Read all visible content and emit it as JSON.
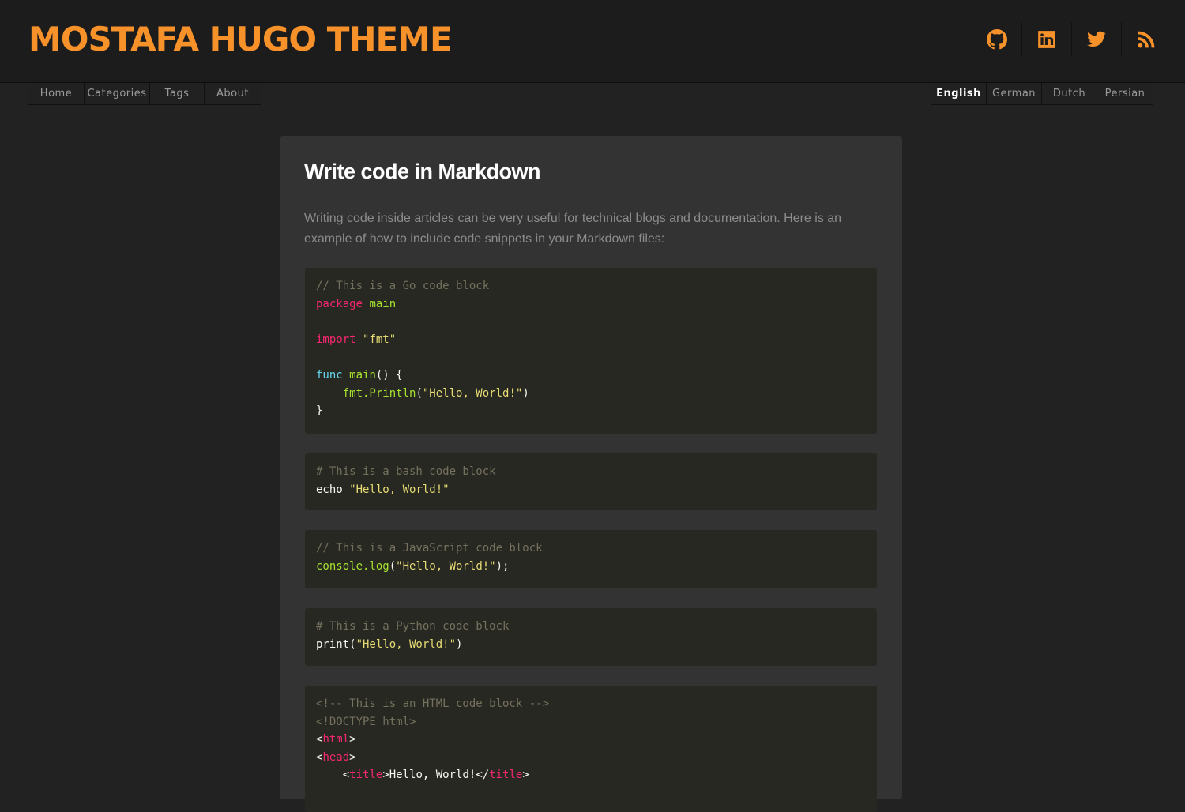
{
  "site": {
    "title": "MOSTAFA HUGO THEME",
    "accent_color": "#f7922b",
    "social_icons": [
      "github-icon",
      "linkedin-icon",
      "twitter-icon",
      "rss-icon"
    ]
  },
  "nav": {
    "main": [
      {
        "label": "Home"
      },
      {
        "label": "Categories"
      },
      {
        "label": "Tags"
      },
      {
        "label": "About"
      }
    ],
    "languages": [
      {
        "label": "English",
        "active": true
      },
      {
        "label": "German"
      },
      {
        "label": "Dutch"
      },
      {
        "label": "Persian"
      }
    ]
  },
  "article": {
    "title": "Write code in Markdown",
    "intro": "Writing code inside articles can be very useful for technical blogs and documentation. Here is an example of how to include code snippets in your Markdown files:"
  },
  "code_blocks": {
    "go": {
      "comment": "// This is a Go code block",
      "package_kw": "package",
      "package_name": "main",
      "import_kw": "import",
      "import_path": "\"fmt\"",
      "func_kw": "func",
      "func_name": "main",
      "func_tail": "() {",
      "call_obj": "fmt.Println",
      "call_open": "(",
      "call_arg": "\"Hello, World!\"",
      "call_close": ")",
      "close_brace": "}"
    },
    "bash": {
      "comment": "# This is a bash code block",
      "cmd": "echo",
      "arg": "\"Hello, World!\""
    },
    "javascript": {
      "comment": "// This is a JavaScript code block",
      "obj": "console",
      "method": ".log",
      "open": "(",
      "arg": "\"Hello, World!\"",
      "close": ");"
    },
    "python": {
      "comment": "# This is a Python code block",
      "fn": "print(",
      "arg": "\"Hello, World!\"",
      "close": ")"
    },
    "html": {
      "comment": "<!-- This is an HTML code block -->",
      "doctype": "<!DOCTYPE html>",
      "html_tag": "html",
      "head_tag": "head",
      "title_tag": "title",
      "title_text": "Hello, World!"
    }
  }
}
